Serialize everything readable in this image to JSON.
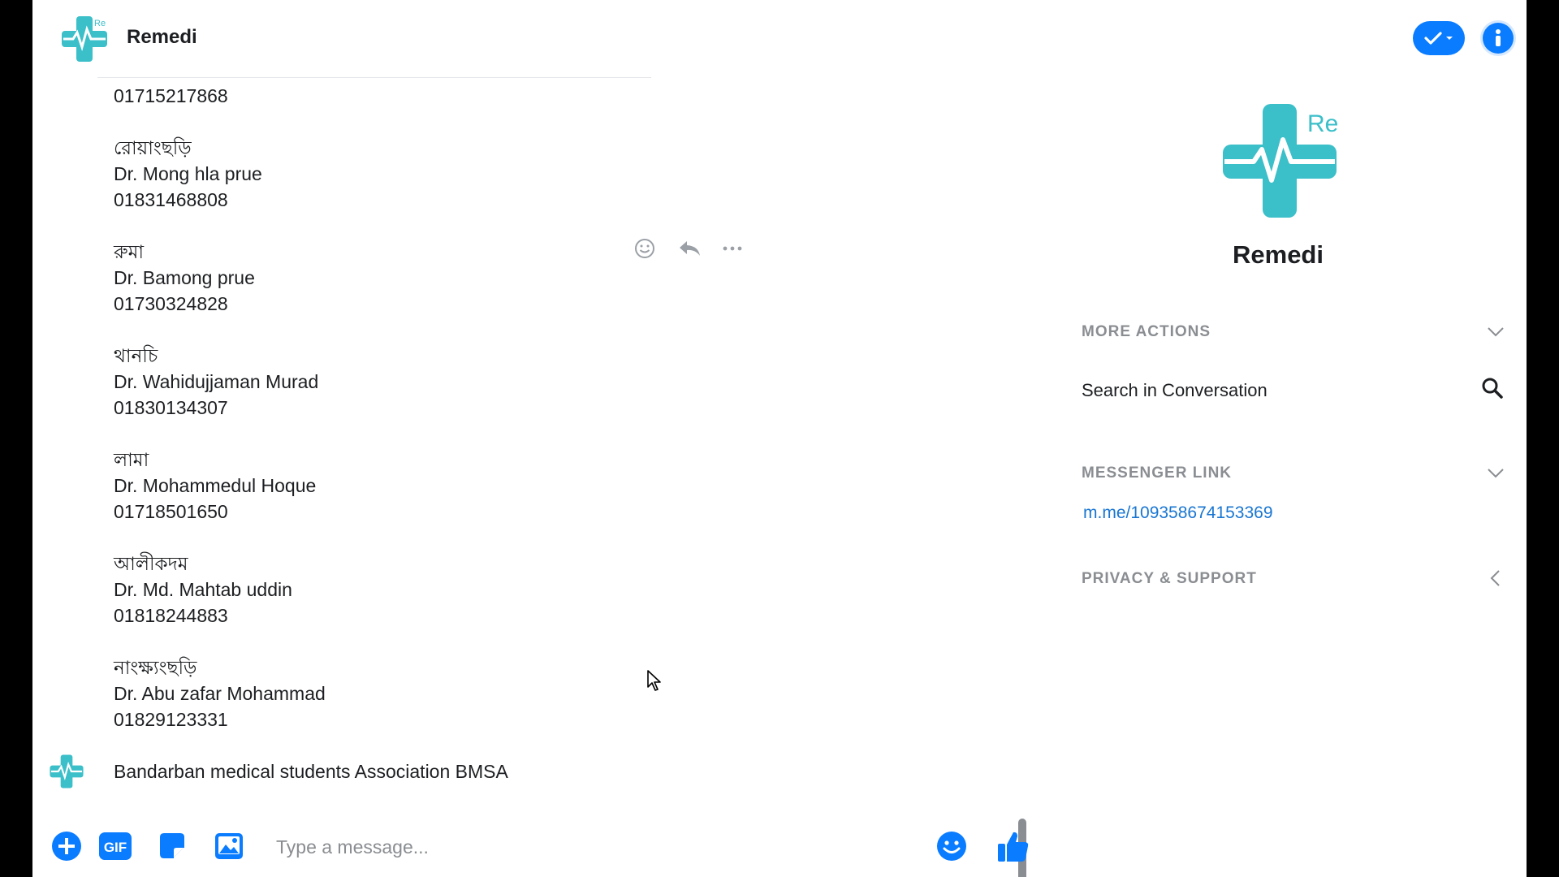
{
  "header": {
    "title": "Remedi",
    "logo_text": "Re"
  },
  "messages": {
    "lines": [
      "01715217868",
      "রোয়াংছড়ি",
      "Dr.  Mong hla prue",
      "01831468808",
      "রুমা",
      "Dr. Bamong prue",
      "01730324828",
      "থানচি",
      "Dr. Wahidujjaman Murad",
      "01830134307",
      "লামা",
      "Dr. Mohammedul Hoque",
      "01718501650",
      "আলীকদম",
      "Dr. Md. Mahtab uddin",
      "01818244883",
      "নাংক্ষ্যংছড়ি",
      "Dr. Abu zafar Mohammad",
      "01829123331"
    ],
    "last_message": "Bandarban medical students Association BMSA"
  },
  "composer": {
    "placeholder": "Type a message...",
    "gif_label": "GIF"
  },
  "panel": {
    "name": "Remedi",
    "more_actions": "MORE ACTIONS",
    "search_label": "Search in Conversation",
    "messenger_link_title": "MESSENGER LINK",
    "messenger_link": "m.me/109358674153369",
    "privacy_support": "PRIVACY & SUPPORT"
  },
  "colors": {
    "accent": "#0a7cff",
    "logo_teal": "#3bbfc9",
    "link": "#1976d2",
    "muted": "#8a8d91"
  }
}
